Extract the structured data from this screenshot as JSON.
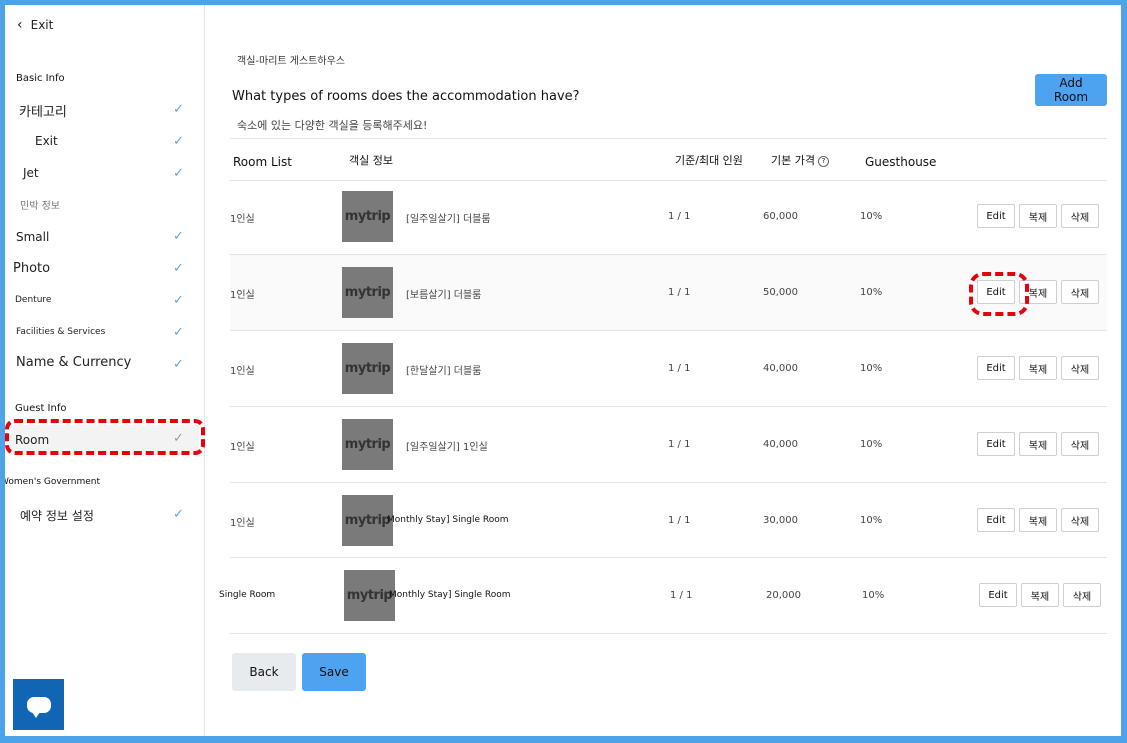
{
  "sidebar": {
    "exit_label": "Exit",
    "sections": {
      "basic_info": "Basic Info",
      "minbak": "민박 정보",
      "guest_info": "Guest Info",
      "womens_gov": "Women's Government"
    },
    "items": {
      "category": "카테고리",
      "exit": "Exit",
      "jet": "Jet",
      "small": "Small",
      "photo": "Photo",
      "denture": "Denture",
      "facilities": "Facilities & Services",
      "name_currency": "Name & Currency",
      "room": "Room",
      "reservation": "예약 정보 설정"
    },
    "check_mark": "✓"
  },
  "header": {
    "breadcrumb": "객실-마리트 게스트하우스",
    "question": "What types of rooms does the accommodation have?",
    "subtitle": "숙소에 있는 다양한 객실을 등록해주세요!",
    "add_room": "Add Room"
  },
  "table": {
    "columns": {
      "room_list": "Room List",
      "room_info": "객실 정보",
      "capacity": "기준/최대 인원",
      "base_price": "기본 가격",
      "guesthouse": "Guesthouse"
    },
    "info_icon": "?",
    "thumb_logo": {
      "pre": "my",
      "mid": "",
      "post": "trip"
    },
    "actions": {
      "edit": "Edit",
      "copy": "복제",
      "delete": "삭제"
    },
    "rows": [
      {
        "type": "1인실",
        "name": "[일주일살기] 더블룸",
        "capacity": "1 / 1",
        "price": "60,000",
        "rate": "10%"
      },
      {
        "type": "1인실",
        "name": "[보름살기] 더블룸",
        "capacity": "1 / 1",
        "price": "50,000",
        "rate": "10%"
      },
      {
        "type": "1인실",
        "name": "[한달살기] 더블룸",
        "capacity": "1 / 1",
        "price": "40,000",
        "rate": "10%"
      },
      {
        "type": "1인실",
        "name": "[일주일살기] 1인실",
        "capacity": "1 / 1",
        "price": "40,000",
        "rate": "10%"
      },
      {
        "type": "1인실",
        "name": "Monthly Stay] Single Room",
        "capacity": "1 / 1",
        "price": "30,000",
        "rate": "10%"
      },
      {
        "type": "Single Room",
        "name": "Monthly Stay] Single Room",
        "capacity": "1 / 1",
        "price": "20,000",
        "rate": "10%"
      }
    ]
  },
  "footer": {
    "back": "Back",
    "save": "Save"
  },
  "colors": {
    "accent": "#4da3f0",
    "highlight": "#e8000b",
    "check": "#5aa9e6"
  }
}
